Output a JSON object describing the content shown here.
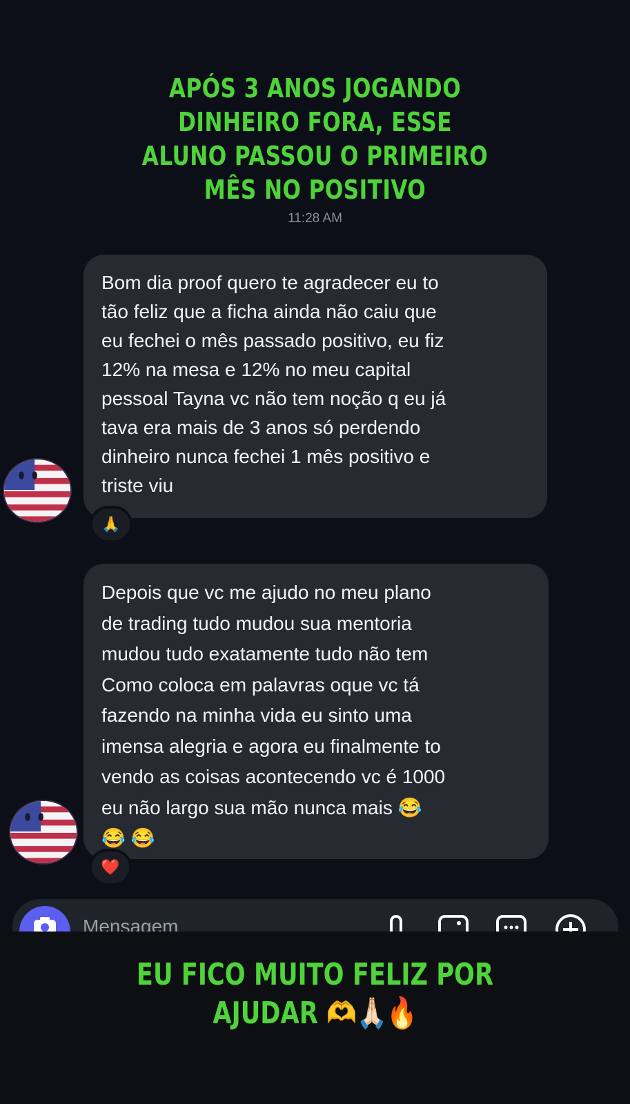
{
  "headline": {
    "lines": [
      "APÓS 3 ANOS JOGANDO",
      "DINHEIRO FORA, ESSE",
      "ALUNO PASSOU O PRIMEIRO",
      "MÊS NO POSITIVO"
    ]
  },
  "timestamp": "11:28 AM",
  "messages": [
    {
      "lines": [
        "Bom dia proof quero te agradecer eu to",
        "tão feliz que a ficha ainda não caiu que",
        "eu fechei o mês passado positivo, eu fiz",
        "12% na mesa e 12% no meu capital",
        "pessoal Tayna vc não tem noção q eu já",
        "tava era mais de 3 anos só perdendo",
        "dinheiro nunca fechei 1 mês positivo e",
        "triste viu"
      ],
      "reaction": "🙏"
    },
    {
      "lines": [
        "Depois que vc me ajudo no meu plano",
        "de trading tudo mudou sua mentoria",
        "mudou tudo exatamente tudo não tem",
        "Como coloca em palavras oque vc tá",
        "fazendo na minha vida eu sinto uma",
        "imensa alegria e agora eu finalmente to",
        "vendo as coisas acontecendo vc é 1000",
        "eu não largo sua mão nunca mais 😂",
        "😂 😂"
      ],
      "reaction": "❤️"
    }
  ],
  "composer": {
    "placeholder": "Mensagem"
  },
  "footer": {
    "lines": [
      "EU FICO MUITO FELIZ POR",
      "AJUDAR 🫶🙏🏻🔥"
    ]
  },
  "colors": {
    "accent_green": "#4fd33a",
    "bubble": "#262a31",
    "background": "#0c0f17",
    "camera_button": "#5a5ff0"
  }
}
